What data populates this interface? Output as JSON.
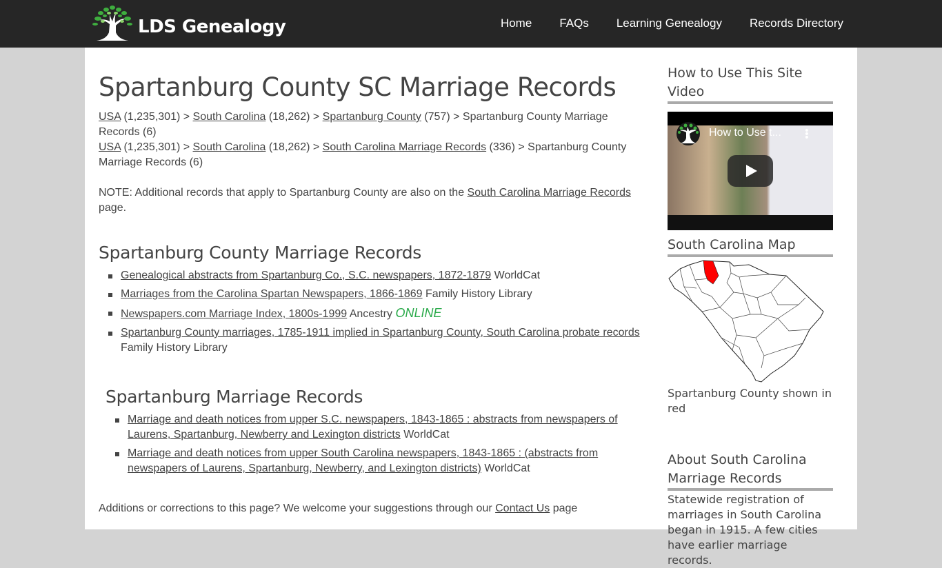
{
  "header": {
    "logo_text": "LDS Genealogy",
    "logo_icon": "tree-icon",
    "nav": [
      {
        "label": "Home"
      },
      {
        "label": "FAQs"
      },
      {
        "label": "Learning Genealogy"
      },
      {
        "label": "Records Directory"
      }
    ]
  },
  "main": {
    "title": "Spartanburg County SC Marriage Records",
    "breadcrumbs": [
      [
        {
          "link": "USA",
          "text": " (1,235,301) > "
        },
        {
          "link": "South Carolina",
          "text": " (18,262) > "
        },
        {
          "link": "Spartanburg County",
          "text": " (757) > Spartanburg County Marriage Records (6)"
        }
      ],
      [
        {
          "link": "USA",
          "text": " (1,235,301) > "
        },
        {
          "link": "South Carolina",
          "text": " (18,262) > "
        },
        {
          "link": "South Carolina Marriage Records",
          "text": " (336) > Spartanburg County Marriage Records (6)"
        }
      ]
    ],
    "note": {
      "prefix": "NOTE: Additional records that apply to Spartanburg County are also on the ",
      "link": "South Carolina Marriage Records",
      "suffix": " page."
    },
    "sections": [
      {
        "heading": "Spartanburg County Marriage Records",
        "items": [
          {
            "link": "Genealogical abstracts from Spartanburg Co., S.C. newspapers, 1872-1879",
            "source": "WorldCat",
            "badge": ""
          },
          {
            "link": "Marriages from the Carolina Spartan Newspapers, 1866-1869",
            "source": "Family History Library",
            "badge": ""
          },
          {
            "link": "Newspapers.com Marriage Index, 1800s-1999",
            "source": "Ancestry",
            "badge": "ONLINE"
          },
          {
            "link": "Spartanburg County marriages, 1785-1911 implied in Spartanburg County, South Carolina probate records",
            "source": "Family History Library",
            "badge": ""
          }
        ]
      },
      {
        "heading": "Spartanburg Marriage Records",
        "items": [
          {
            "link": "Marriage and death notices from upper S.C. newspapers, 1843-1865 : abstracts from newspapers of Laurens, Spartanburg, Newberry and Lexington districts",
            "source": "WorldCat",
            "badge": ""
          },
          {
            "link": "Marriage and death notices from upper South Carolina newspapers, 1843-1865 : (abstracts from newspapers of Laurens, Spartanburg, Newberry, and Lexington districts)",
            "source": "WorldCat",
            "badge": ""
          }
        ]
      }
    ],
    "footer_note": {
      "prefix": "Additions or corrections to this page? We welcome your suggestions through our ",
      "link": "Contact Us",
      "suffix": " page"
    }
  },
  "sidebar": {
    "video_heading": "How to Use This Site Video",
    "video_title": "How to Use t...",
    "map_heading": "South Carolina Map",
    "map_caption": "Spartanburg County shown in red",
    "map_highlight_color": "#ff0000",
    "about_heading": "About South Carolina Marriage Records",
    "about_text": "Statewide registration of marriages in South Carolina began in 1915. A few cities have earlier marriage records."
  },
  "colors": {
    "header_bg": "#262626",
    "page_bg": "#d3d3d3",
    "online_badge": "#2aaa4a"
  }
}
